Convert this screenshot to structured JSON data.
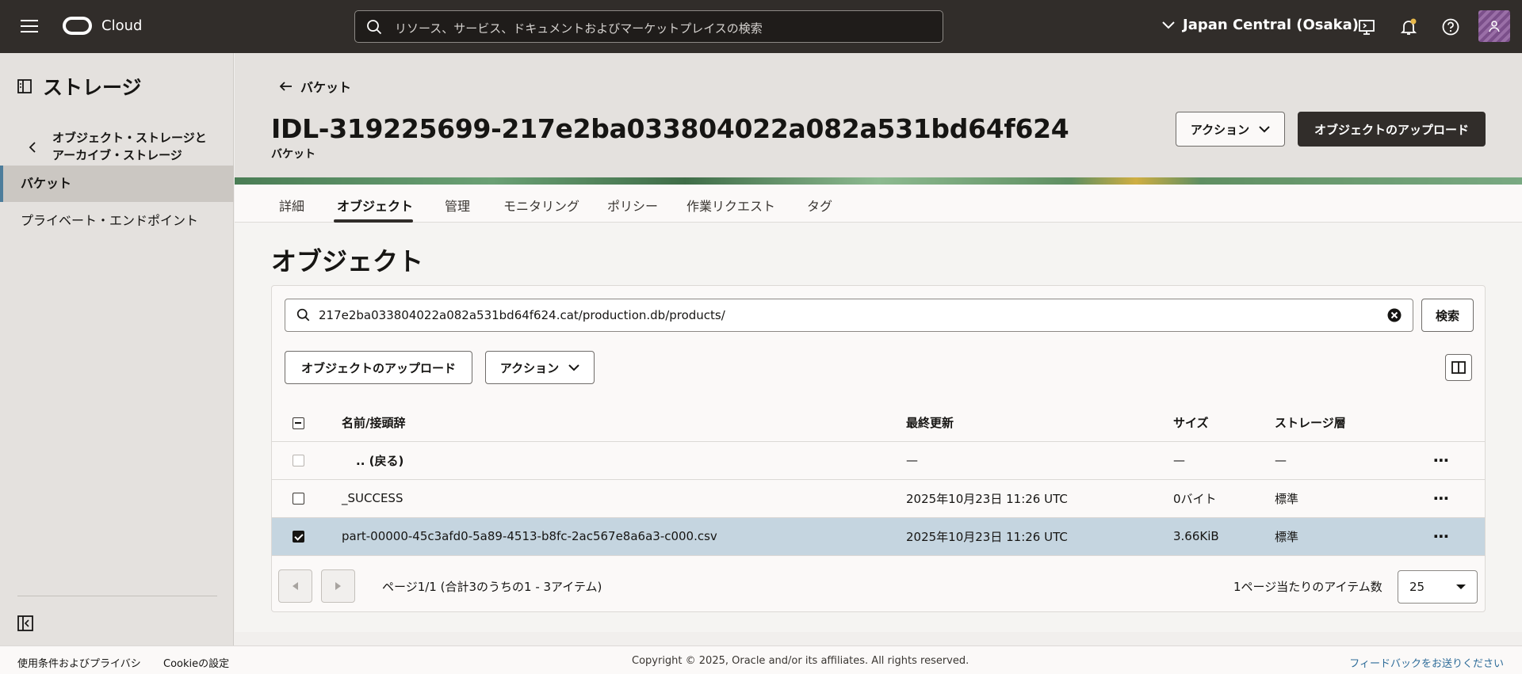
{
  "header": {
    "brand": "Cloud",
    "search_placeholder": "リソース、サービス、ドキュメントおよびマーケットプレイスの検索",
    "region": "Japan Central (Osaka)"
  },
  "sidebar": {
    "title": "ストレージ",
    "back_label_line1": "オブジェクト・ストレージと",
    "back_label_line2": "アーカイブ・ストレージ",
    "items": [
      {
        "label": "バケット",
        "active": true
      },
      {
        "label": "プライベート・エンドポイント",
        "active": false
      }
    ]
  },
  "page": {
    "back_link": "バケット",
    "title": "IDL-319225699-217e2ba033804022a082a531bd64f624",
    "subtitle": "バケット",
    "actions_label": "アクション",
    "upload_label": "オブジェクトのアップロード"
  },
  "tabs": [
    {
      "label": "詳細"
    },
    {
      "label": "オブジェクト"
    },
    {
      "label": "管理"
    },
    {
      "label": "モニタリング"
    },
    {
      "label": "ポリシー"
    },
    {
      "label": "作業リクエスト"
    },
    {
      "label": "タグ"
    }
  ],
  "objects": {
    "section_title": "オブジェクト",
    "filter_value": "217e2ba033804022a082a531bd64f624.cat/production.db/products/",
    "search_button": "検索",
    "upload_button": "オブジェクトのアップロード",
    "actions_button": "アクション",
    "columns": {
      "name": "名前/接頭辞",
      "modified": "最終更新",
      "size": "サイズ",
      "tier": "ストレージ層"
    },
    "rows": [
      {
        "name": ".. (戻る)",
        "modified": "—",
        "size": "—",
        "tier": "—",
        "checked": false,
        "disabled": true
      },
      {
        "name": "_SUCCESS",
        "modified": "2025年10月23日 11:26 UTC",
        "size": "0バイト",
        "tier": "標準",
        "checked": false,
        "disabled": false
      },
      {
        "name": "part-00000-45c3afd0-5a89-4513-b8fc-2ac567e8a6a3-c000.csv",
        "modified": "2025年10月23日 11:26 UTC",
        "size": "3.66KiB",
        "tier": "標準",
        "checked": true,
        "disabled": false
      }
    ],
    "pager_text": "ページ1/1 (合計3のうちの1 - 3アイテム)",
    "per_page_label": "1ページ当たりのアイテム数",
    "per_page_value": "25"
  },
  "footer": {
    "terms": "使用条件およびプライバシ",
    "cookie": "Cookieの設定",
    "copyright": "Copyright © 2025, Oracle and/or its affiliates. All rights reserved.",
    "feedback": "フィードバックをお送りください"
  }
}
